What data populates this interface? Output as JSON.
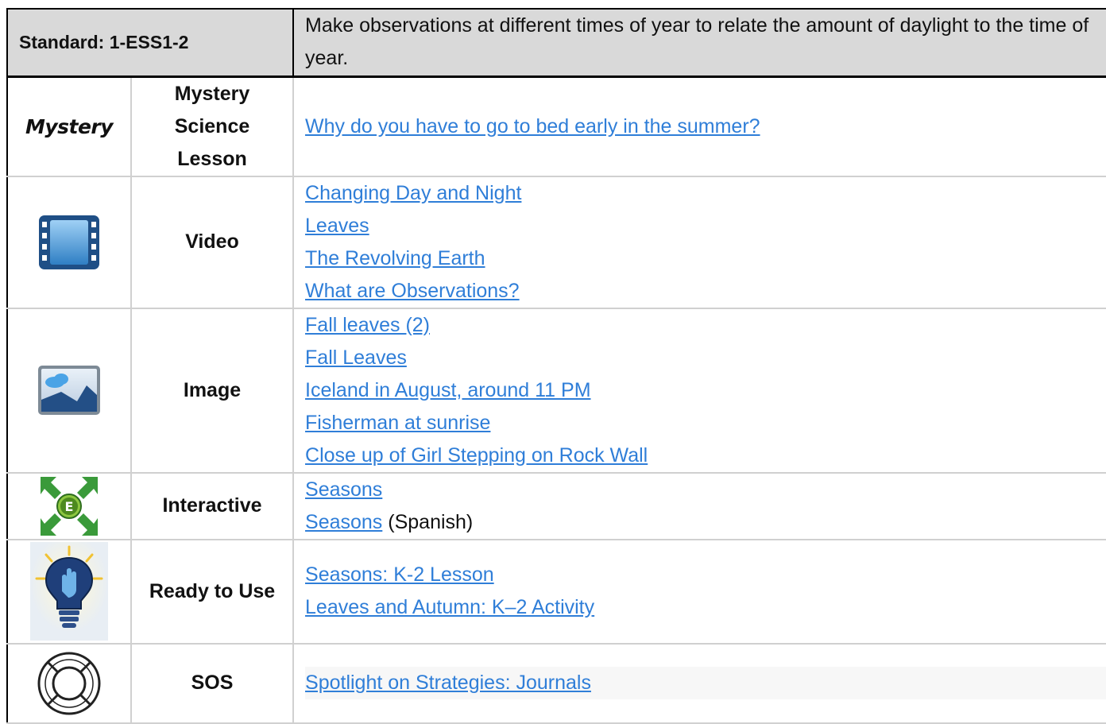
{
  "standard": {
    "label": "Standard: 1-ESS1-2",
    "description": "Make observations at different times of year to relate the amount of daylight to the time of year."
  },
  "rows": [
    {
      "icon": "mystery-logo",
      "logo_text": "Mystery",
      "type": "Mystery Science Lesson",
      "links": [
        "Why do you have to go to bed early in the summer?"
      ]
    },
    {
      "icon": "film-strip-icon",
      "type": "Video",
      "links": [
        "Changing Day and Night",
        "Leaves",
        "The Revolving Earth",
        "What are Observations?"
      ]
    },
    {
      "icon": "picture-icon",
      "type": "Image",
      "links": [
        "Fall leaves (2)",
        "Fall Leaves",
        "Iceland in August, around 11 PM",
        "Fisherman at sunrise",
        "Close up of Girl Stepping on Rock Wall"
      ]
    },
    {
      "icon": "explore-arrows-icon",
      "icon_letter": "E",
      "type": "Interactive",
      "links": [
        "Seasons",
        "Seasons"
      ],
      "link_suffix": "(Spanish)"
    },
    {
      "icon": "lightbulb-hand-icon",
      "type": "Ready to Use",
      "links": [
        "Seasons: K-2 Lesson",
        "Leaves and Autumn: K–2 Activity"
      ]
    },
    {
      "icon": "life-ring-icon",
      "type": "SOS",
      "links": [
        "Spotlight on Strategies: Journals"
      ]
    }
  ],
  "colors": {
    "link": "#2f7ed8",
    "header_bg": "#d9d9d9",
    "border": "#d0d0d0"
  }
}
